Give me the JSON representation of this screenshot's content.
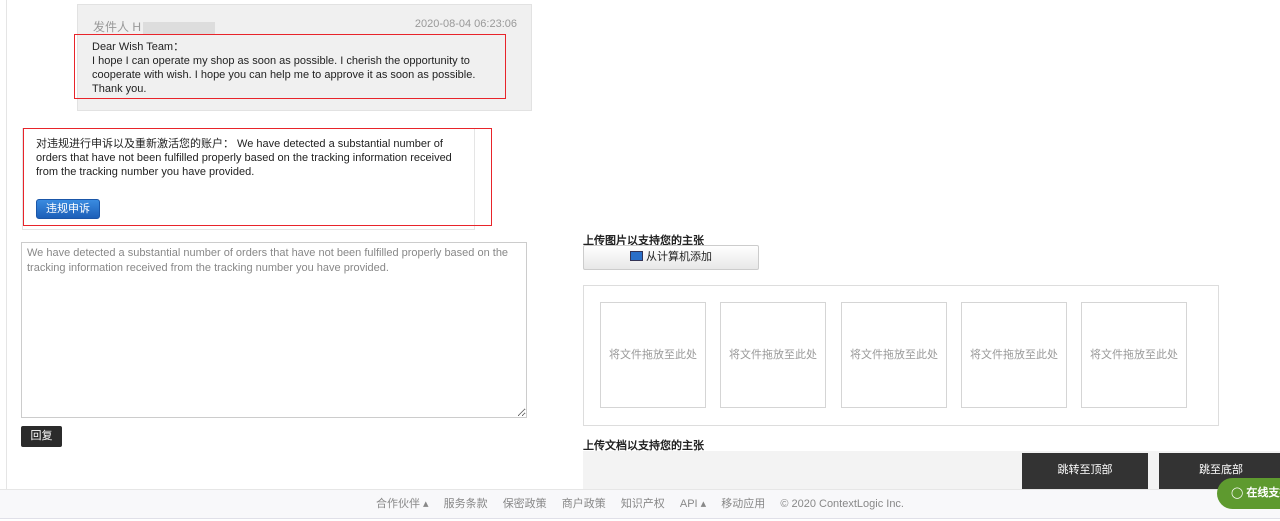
{
  "message": {
    "sender_label": "发件人 H",
    "timestamp": "2020-08-04 06:23:06",
    "greeting": "Dear Wish Team：",
    "body": "I hope I can operate my shop as soon as possible. I cherish the opportunity to cooperate with wish. I hope you can help me to approve it as soon as possible. Thank you."
  },
  "appeal": {
    "text": "对违规进行申诉以及重新激活您的账户： We have detected a substantial number of orders that have not been fulfilled properly based on the tracking information received from the tracking number you have provided.",
    "button": "违规申诉"
  },
  "reply": {
    "textarea_value": "We have detected a substantial number of orders that have not been fulfilled properly based on the tracking information received from the tracking number you have provided.",
    "button": "回复"
  },
  "upload": {
    "image_label": "上传图片以支持您的主张",
    "add_button": "从计算机添加",
    "drop_zones": [
      "将文件拖放至此处",
      "将文件拖放至此处",
      "将文件拖放至此处",
      "将文件拖放至此处",
      "将文件拖放至此处"
    ],
    "doc_label": "上传文档以支持您的主张"
  },
  "nav": {
    "top": "跳转至顶部",
    "bottom": "跳至底部"
  },
  "footer": {
    "links": [
      "合作伙伴 ▴",
      "服务条款",
      "保密政策",
      "商户政策",
      "知识产权",
      "API ▴",
      "移动应用"
    ],
    "copyright": "© 2020 ContextLogic Inc."
  },
  "chat": {
    "label": "在线支持"
  }
}
